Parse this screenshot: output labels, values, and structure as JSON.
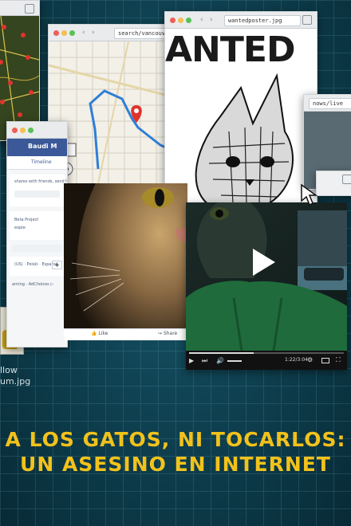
{
  "map_top_left": {
    "tab_icon": "tab-icon"
  },
  "map_window": {
    "url": "search/vancouver"
  },
  "wanted_window": {
    "url": "wantedposter.jpg",
    "heading": "ANTED"
  },
  "facebook_window": {
    "profile_name": "Baudi M",
    "tab_label": "Timeline",
    "post_text": "shares with friends, send her a f",
    "project_text": "Beta Project",
    "people_text": "eople",
    "language_text": "(US) · Polski · Español",
    "adchoices_text": "arning · AdChoices ▷",
    "plus_label": "+",
    "like_label": "Like",
    "share_label": "Share"
  },
  "right_window": {
    "url": "nows/live"
  },
  "video_player": {
    "time": "1:22/3:04",
    "progress": 0.42
  },
  "file_caption": {
    "line1": "llow",
    "line2": "um.jpg"
  },
  "title": {
    "line1": "A LOS GATOS, NI TOCARLOS:",
    "line2": "UN ASESINO EN INTERNET"
  },
  "colors": {
    "title_yellow": "#f2c21b",
    "background_teal": "#0f4252",
    "route_blue": "#2f7fd6",
    "pin_red": "#e0332d"
  }
}
